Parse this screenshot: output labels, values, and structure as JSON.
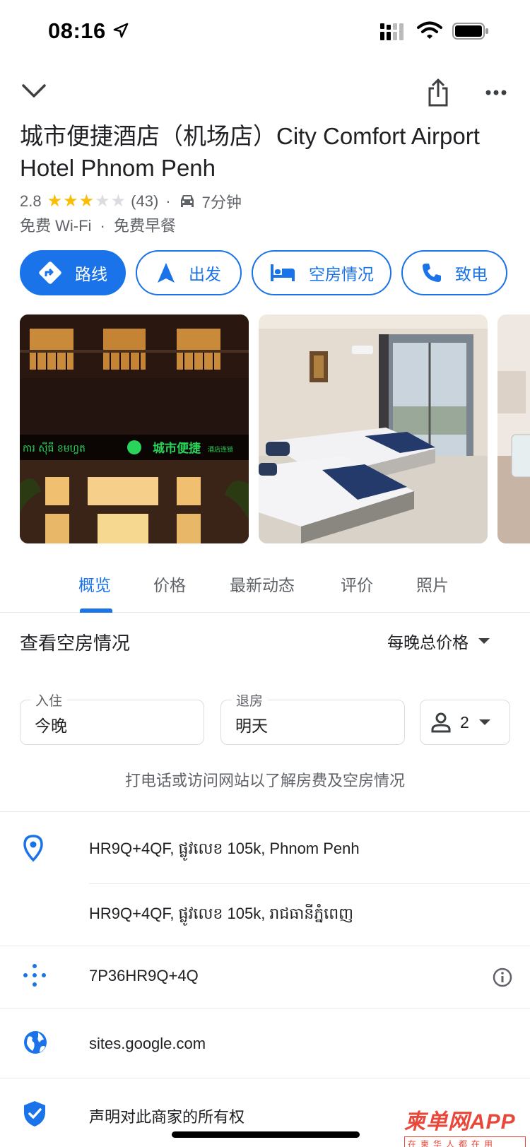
{
  "status_bar": {
    "time": "08:16"
  },
  "place": {
    "title": "城市便捷酒店（机场店）City Comfort Airport Hotel Phnom Penh",
    "rating": "2.8",
    "stars": 3,
    "reviews": "(43)",
    "drive_time": "7分钟",
    "amenity_1": "免费 Wi-Fi",
    "amenity_2": "免费早餐"
  },
  "actions": {
    "directions": "路线",
    "start": "出发",
    "availability": "空房情况",
    "call": "致电"
  },
  "tabs": {
    "overview": "概览",
    "prices": "价格",
    "updates": "最新动态",
    "reviews": "评价",
    "photos": "照片"
  },
  "availability": {
    "title": "查看空房情况",
    "price_mode": "每晚总价格",
    "checkin_label": "入住",
    "checkin_value": "今晚",
    "checkout_label": "退房",
    "checkout_value": "明天",
    "guests": "2",
    "note": "打电话或访问网站以了解房费及空房情况"
  },
  "info": {
    "address_en": "HR9Q+4QF, ផ្លូវលេខ 105k, Phnom Penh",
    "address_km": "HR9Q+4QF, ផ្លូវលេខ 105k, រាជធានីភ្នំពេញ",
    "plus_code": "7P36HR9Q+4Q",
    "website": "sites.google.com",
    "claim": "声明对此商家的所有权"
  },
  "photos": {
    "sign_km": "ការ ស៊ីធី ខមហ្វត",
    "sign_cn": "城市便捷",
    "sign_cn_small": "酒店连锁"
  },
  "watermark": {
    "main": "柬单网APP",
    "sub": "在柬华人都在用"
  },
  "colors": {
    "accent": "#1a73e8",
    "star": "#fbbc04",
    "text_secondary": "#5f6368",
    "watermark": "#e8473a"
  },
  "icons": [
    "location-arrow-icon",
    "signal-icon",
    "wifi-icon",
    "battery-icon",
    "chevron-down-icon",
    "share-icon",
    "more-icon",
    "car-icon",
    "directions-icon",
    "navigation-icon",
    "bed-icon",
    "phone-icon",
    "person-icon",
    "place-pin-icon",
    "plus-code-icon",
    "info-icon",
    "globe-icon",
    "verified-shield-icon"
  ]
}
